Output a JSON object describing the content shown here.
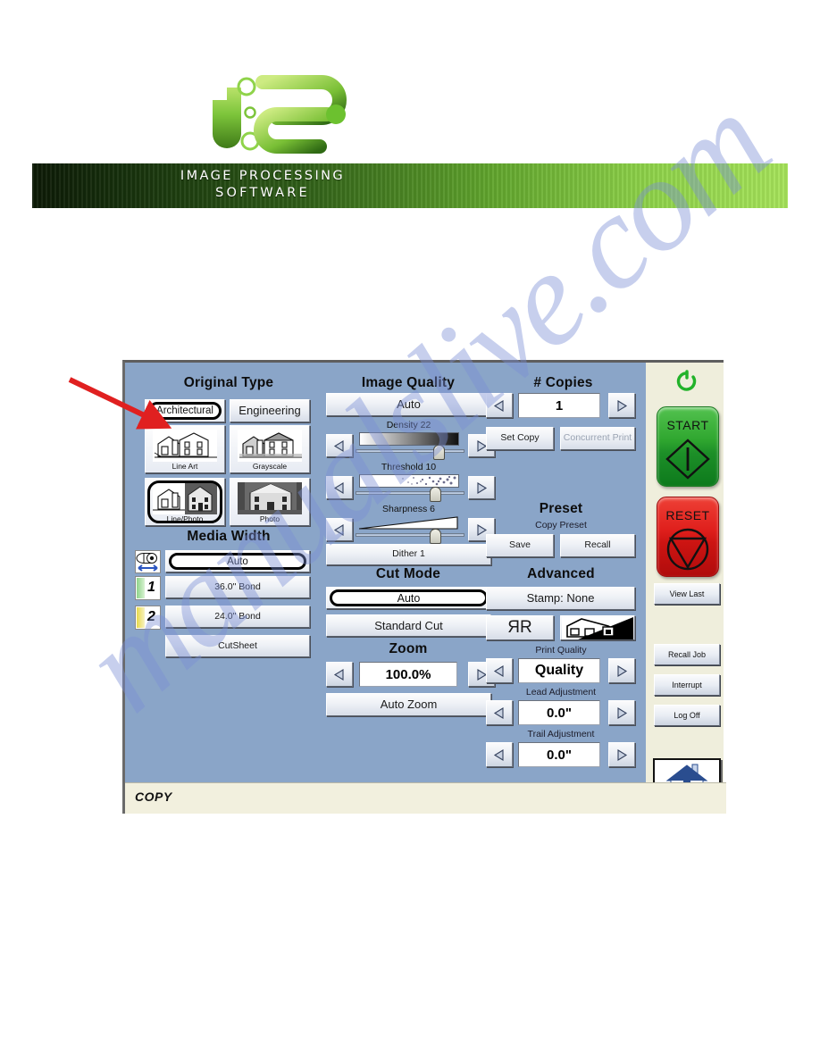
{
  "header": {
    "logo_alt": "ips-logo",
    "banner_line1": "IMAGE PROCESSING",
    "banner_line2": "SOFTWARE",
    "banner_color_left": "#0d1a06",
    "banner_color_right": "#a6e35a"
  },
  "watermark": {
    "text": "manualslive.com"
  },
  "annotation": {
    "arrow_color": "#e02020",
    "points_to": "Architectural"
  },
  "screen": {
    "background": "#8aa5c8",
    "status_text": "COPY"
  },
  "original_type": {
    "title": "Original Type",
    "mode_buttons": [
      {
        "label": "Architectural",
        "selected": true
      },
      {
        "label": "Engineering",
        "selected": false
      }
    ],
    "thumbnails": [
      {
        "label": "Line Art",
        "icon": "house-line-art-icon",
        "selected": false
      },
      {
        "label": "Grayscale",
        "icon": "house-grayscale-icon",
        "selected": false
      },
      {
        "label": "Line/Photo",
        "icon": "house-line-photo-icon",
        "selected": true
      },
      {
        "label": "Photo",
        "icon": "house-photo-icon",
        "selected": false
      }
    ]
  },
  "media_width": {
    "title": "Media Width",
    "roll_icon": "paper-roll-width-icon",
    "items": [
      {
        "label": "Auto",
        "selected": true,
        "badge": "",
        "badge_color": ""
      },
      {
        "label": "36.0\" Bond",
        "selected": false,
        "badge": "1",
        "badge_color": "#6ebf5e"
      },
      {
        "label": "24.0\" Bond",
        "selected": false,
        "badge": "2",
        "badge_color": "#efe04a"
      },
      {
        "label": "CutSheet",
        "selected": false,
        "badge": "",
        "badge_color": ""
      }
    ]
  },
  "image_quality": {
    "title": "Image Quality",
    "auto_label": "Auto",
    "sliders": [
      {
        "label": "Density 22",
        "value": 22,
        "knob_pct": 76,
        "kind": "density"
      },
      {
        "label": "Threshold 10",
        "value": 10,
        "knob_pct": 74,
        "kind": "threshold"
      },
      {
        "label": "Sharpness 6",
        "value": 6,
        "knob_pct": 74,
        "kind": "sharpness"
      }
    ],
    "dither_label": "Dither 1",
    "dec_icon": "left-triangle-icon",
    "inc_icon": "right-triangle-icon"
  },
  "cut_mode": {
    "title": "Cut Mode",
    "options": [
      {
        "label": "Auto",
        "selected": true
      },
      {
        "label": "Standard Cut",
        "selected": false
      }
    ]
  },
  "zoom": {
    "title": "Zoom",
    "value": "100.0%",
    "auto_label": "Auto Zoom",
    "dec_icon": "left-triangle-icon",
    "inc_icon": "right-triangle-icon"
  },
  "copies": {
    "title": "# Copies",
    "value": "1",
    "dec_icon": "left-triangle-icon",
    "inc_icon": "right-triangle-icon",
    "set_copy_label": "Set Copy",
    "concurrent_print_label": "Concurrent Print",
    "concurrent_print_disabled": true
  },
  "preset": {
    "title": "Preset",
    "subtitle": "Copy Preset",
    "save_label": "Save",
    "recall_label": "Recall"
  },
  "advanced": {
    "title": "Advanced",
    "stamp_label": "Stamp: None",
    "mirror_icon": "mirror-rr-icon",
    "mirror_label": "ЯR",
    "invert_icon": "invert-house-icon",
    "print_quality": {
      "label": "Print Quality",
      "value": "Quality"
    },
    "lead_adjustment": {
      "label": "Lead Adjustment",
      "value": "0.0\""
    },
    "trail_adjustment": {
      "label": "Trail Adjustment",
      "value": "0.0\""
    }
  },
  "rail": {
    "power_icon": "power-ring-icon",
    "power_color": "#22b22a",
    "start": {
      "label": "START",
      "icon": "start-diamond-icon",
      "color": "#2fa62f"
    },
    "reset": {
      "label": "RESET",
      "icon": "reset-triangle-icon",
      "color": "#df1f1c"
    },
    "buttons": [
      {
        "label": "View Last"
      },
      {
        "label": "Recall Job"
      },
      {
        "label": "Interrupt"
      },
      {
        "label": "Log Off"
      }
    ],
    "home_icon": "home-house-icon"
  }
}
